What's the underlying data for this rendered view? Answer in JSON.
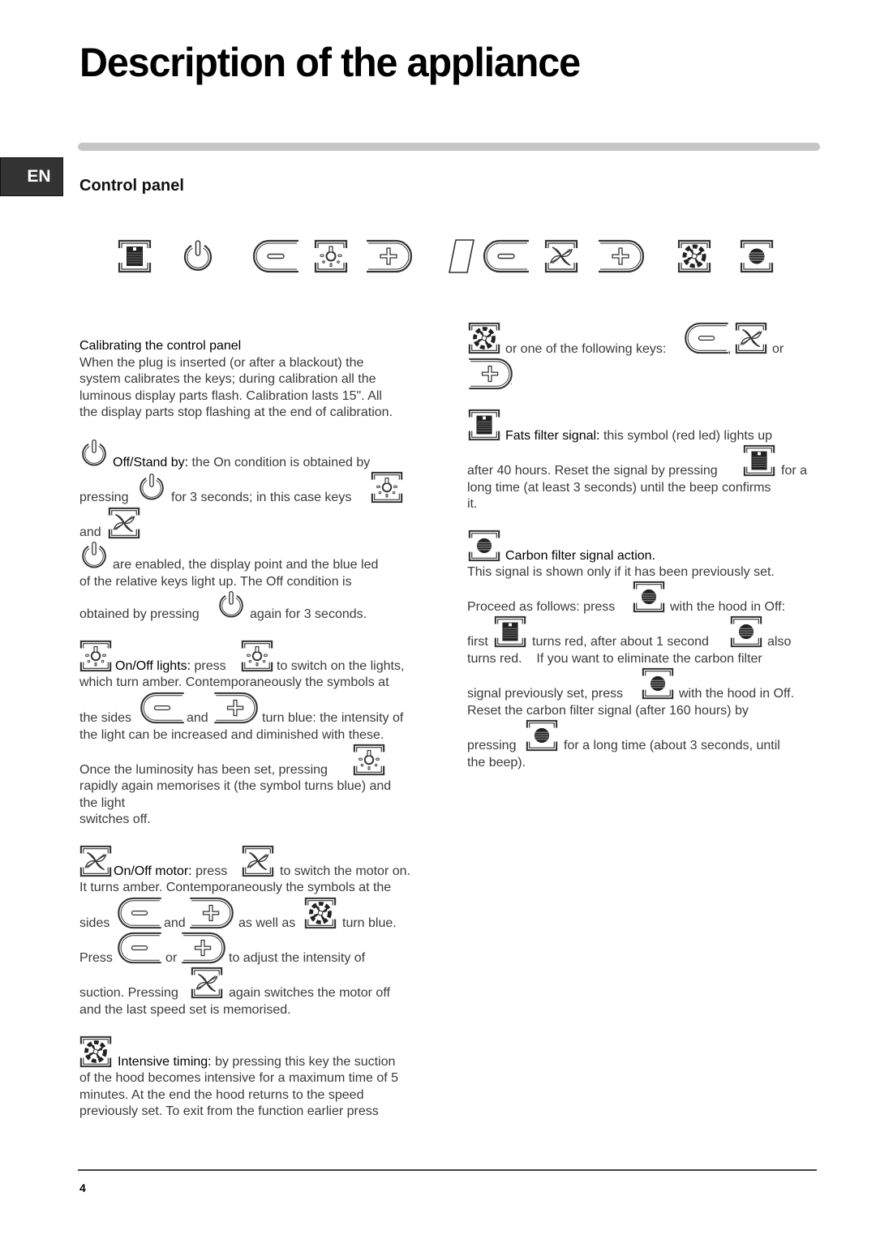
{
  "page": {
    "title": "Description of the appliance",
    "language_tab": "EN",
    "section_title": "Control panel",
    "page_number": "4"
  },
  "control_panel": {
    "keys": [
      {
        "icon": "fats-filter-icon",
        "function": "Fats filter signal"
      },
      {
        "icon": "power-icon",
        "function": "Off/Stand by"
      },
      {
        "icon": "minus-key-icon",
        "function": "Decrease light"
      },
      {
        "icon": "light-icon",
        "function": "On/Off lights"
      },
      {
        "icon": "plus-key-icon",
        "function": "Increase light"
      },
      {
        "icon": "display-icon",
        "function": "Display"
      },
      {
        "icon": "minus-key-icon",
        "function": "Decrease speed"
      },
      {
        "icon": "fan-icon",
        "function": "On/Off motor"
      },
      {
        "icon": "plus-key-icon",
        "function": "Increase speed"
      },
      {
        "icon": "intensive-fan-icon",
        "function": "Intensive timing"
      },
      {
        "icon": "carbon-filter-icon",
        "function": "Carbon filter signal"
      }
    ]
  },
  "left": {
    "calibrating": {
      "heading": "Calibrating the control panel",
      "lines": [
        "When the plug is inserted (or after a blackout) the",
        "system calibrates the keys; during calibration all the",
        "luminous display parts flash. Calibration lasts 15\". All",
        "the display parts stop flashing at the end of calibration."
      ]
    },
    "standby": {
      "label": "Off/Stand by:",
      "l1": "the On condition is obtained by",
      "l2a": "pressing",
      "l2b": "for 3 seconds; in this case keys",
      "l3": "and",
      "l4": "are enabled, the display point and the blue led",
      "l5": "of the relative keys light up. The Off condition is",
      "l6a": "obtained by pressing",
      "l6b": "again for 3 seconds."
    },
    "lights": {
      "label": "On/Off lights:",
      "l1a": "press",
      "l1b": "to switch on the lights,",
      "l2": "which turn amber. Contemporaneously the symbols at",
      "l3a": "the sides",
      "l3b": "and",
      "l3c": "turn blue: the intensity of",
      "l4": "the light can be increased and diminished with these.",
      "l5": "Once the luminosity has been set, pressing",
      "l6": "rapidly again memorises it (the symbol turns blue) and",
      "l7": "the light",
      "l8": "switches off."
    },
    "motor": {
      "label": "On/Off motor:",
      "l1a": "press",
      "l1b": "to switch the motor on.",
      "l2": "It turns amber. Contemporaneously the symbols at the",
      "l3a": "sides",
      "l3b": "and",
      "l3c": "as well as",
      "l3d": "turn blue.",
      "l4a": "Press",
      "l4b": "or",
      "l4c": "to adjust the intensity of",
      "l5a": "suction. Pressing",
      "l5b": "again switches the motor off",
      "l6": "and the last speed set is memorised."
    },
    "intensive": {
      "label": "Intensive timing:",
      "l1": "by pressing this key the suction",
      "l2": "of the hood becomes intensive for a maximum time of 5",
      "l3": "minutes. At the end the hood returns to the speed",
      "l4": "previously set. To exit from the function earlier press"
    }
  },
  "right": {
    "cont": {
      "l1a": "or one of the following keys:",
      "l1b": ",",
      "l1c": "or",
      "l2": "."
    },
    "fats": {
      "label": "Fats filter signal:",
      "l1": "this symbol (red led) lights up",
      "l2a": "after 40 hours. Reset the signal by pressing",
      "l2b": "for a",
      "l3": "long time (at least 3 seconds) until the beep confirms",
      "l4": "it."
    },
    "carbon": {
      "label": "Carbon filter signal action.",
      "l1": "This signal is shown only if it has been previously set.",
      "l2a": "Proceed as follows: press",
      "l2b": "with the hood in Off:",
      "l3a": "first",
      "l3b": "turns red, after about 1 second",
      "l3c": "also",
      "l4": "turns red.    If you want to eliminate the carbon filter",
      "l5a": "signal previously set, press",
      "l5b": "with the hood in Off.",
      "l6": "Reset the carbon filter signal (after 160 hours) by",
      "l7a": "pressing",
      "l7b": "for a long time (about 3 seconds, until",
      "l8": "the beep)."
    }
  }
}
